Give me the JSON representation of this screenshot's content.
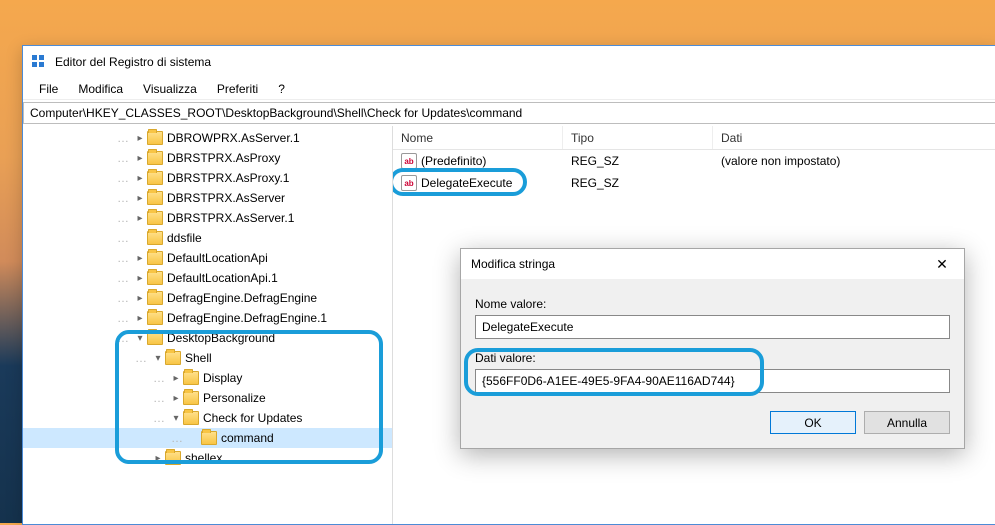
{
  "window": {
    "title": "Editor del Registro di sistema",
    "address": "Computer\\HKEY_CLASSES_ROOT\\DesktopBackground\\Shell\\Check for Updates\\command"
  },
  "menu": {
    "file": "File",
    "edit": "Modifica",
    "view": "Visualizza",
    "favorites": "Preferiti",
    "help": "?"
  },
  "tree": [
    {
      "indent": 3,
      "exp": "▸",
      "label": "DBROWPRX.AsServer.1"
    },
    {
      "indent": 3,
      "exp": "▸",
      "label": "DBRSTPRX.AsProxy"
    },
    {
      "indent": 3,
      "exp": "▸",
      "label": "DBRSTPRX.AsProxy.1"
    },
    {
      "indent": 3,
      "exp": "▸",
      "label": "DBRSTPRX.AsServer"
    },
    {
      "indent": 3,
      "exp": "▸",
      "label": "DBRSTPRX.AsServer.1"
    },
    {
      "indent": 3,
      "exp": "",
      "label": "ddsfile"
    },
    {
      "indent": 3,
      "exp": "▸",
      "label": "DefaultLocationApi"
    },
    {
      "indent": 3,
      "exp": "▸",
      "label": "DefaultLocationApi.1"
    },
    {
      "indent": 3,
      "exp": "▸",
      "label": "DefragEngine.DefragEngine"
    },
    {
      "indent": 3,
      "exp": "▸",
      "label": "DefragEngine.DefragEngine.1"
    },
    {
      "indent": 3,
      "exp": "▾",
      "label": "DesktopBackground"
    },
    {
      "indent": 4,
      "exp": "▾",
      "label": "Shell"
    },
    {
      "indent": 5,
      "exp": "▸",
      "label": "Display"
    },
    {
      "indent": 5,
      "exp": "▸",
      "label": "Personalize"
    },
    {
      "indent": 5,
      "exp": "▾",
      "label": "Check for Updates"
    },
    {
      "indent": 6,
      "exp": "",
      "label": "command",
      "selected": true
    },
    {
      "indent": 4,
      "exp": "▸",
      "label": "shellex"
    }
  ],
  "list": {
    "headers": {
      "name": "Nome",
      "type": "Tipo",
      "data": "Dati"
    },
    "rows": [
      {
        "name": "(Predefinito)",
        "type": "REG_SZ",
        "data": "(valore non impostato)"
      },
      {
        "name": "DelegateExecute",
        "type": "REG_SZ",
        "data": ""
      }
    ]
  },
  "dialog": {
    "title": "Modifica stringa",
    "name_label": "Nome valore:",
    "name_value": "DelegateExecute",
    "data_label": "Dati valore:",
    "data_value": "{556FF0D6-A1EE-49E5-9FA4-90AE116AD744}",
    "ok": "OK",
    "cancel": "Annulla"
  }
}
